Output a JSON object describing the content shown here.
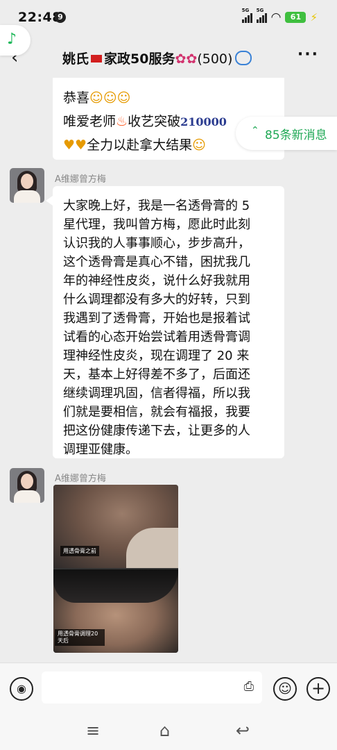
{
  "status_bar": {
    "time": "22:48",
    "notification_count": "9",
    "signal1_label": "5G",
    "signal2_label": "5G",
    "battery": "61"
  },
  "header": {
    "title_part1": "姚氏",
    "title_part2": "家政50服务",
    "member_count": "(500)"
  },
  "messages": {
    "first": {
      "line1": "恭喜",
      "line2_a": "唯爱老师",
      "line2_b": "收艺突破",
      "line2_num": "210000",
      "line3": "全力以赴拿大结果"
    },
    "second": {
      "sender": "A维娜曾方梅",
      "lines": [
        "大家晚上好，我是一名透骨膏的 5",
        "星代理，我叫曾方梅，愿此时此刻",
        "认识我的人事事顺心，步步高升，",
        "这个透骨膏是真心不错，困扰我几",
        "年的神经性皮炎，说什么好我就用",
        "什么调理都没有多大的好转，只到",
        "我遇到了透骨膏，开始也是报着试",
        "试看的心态开始尝试着用透骨膏调",
        "理神经性皮炎，现在调理了 20 来",
        "天，基本上好得差不多了，后面还",
        "继续调理巩固，信者得福，所以我",
        "们就是要相信，就会有福报，我要",
        "把这份健康传递下去，让更多的人",
        "调理亚健康。"
      ]
    },
    "third": {
      "sender": "A维娜曾方梅",
      "photo_label_top": "用透骨膏之前",
      "photo_label_bottom": "用透骨膏调理20天后"
    }
  },
  "new_messages_badge": "85条新消息",
  "icons": {
    "music": "music-note-icon",
    "back": "back-arrow-icon",
    "more": "more-dots-icon",
    "voice": "voice-input-icon",
    "mic": "microphone-icon",
    "emoji": "emoji-icon",
    "plus": "plus-icon"
  },
  "colors": {
    "accent_green": "#1fa855",
    "battery_green": "#3fbf3f",
    "chat_bg": "#ededed"
  }
}
